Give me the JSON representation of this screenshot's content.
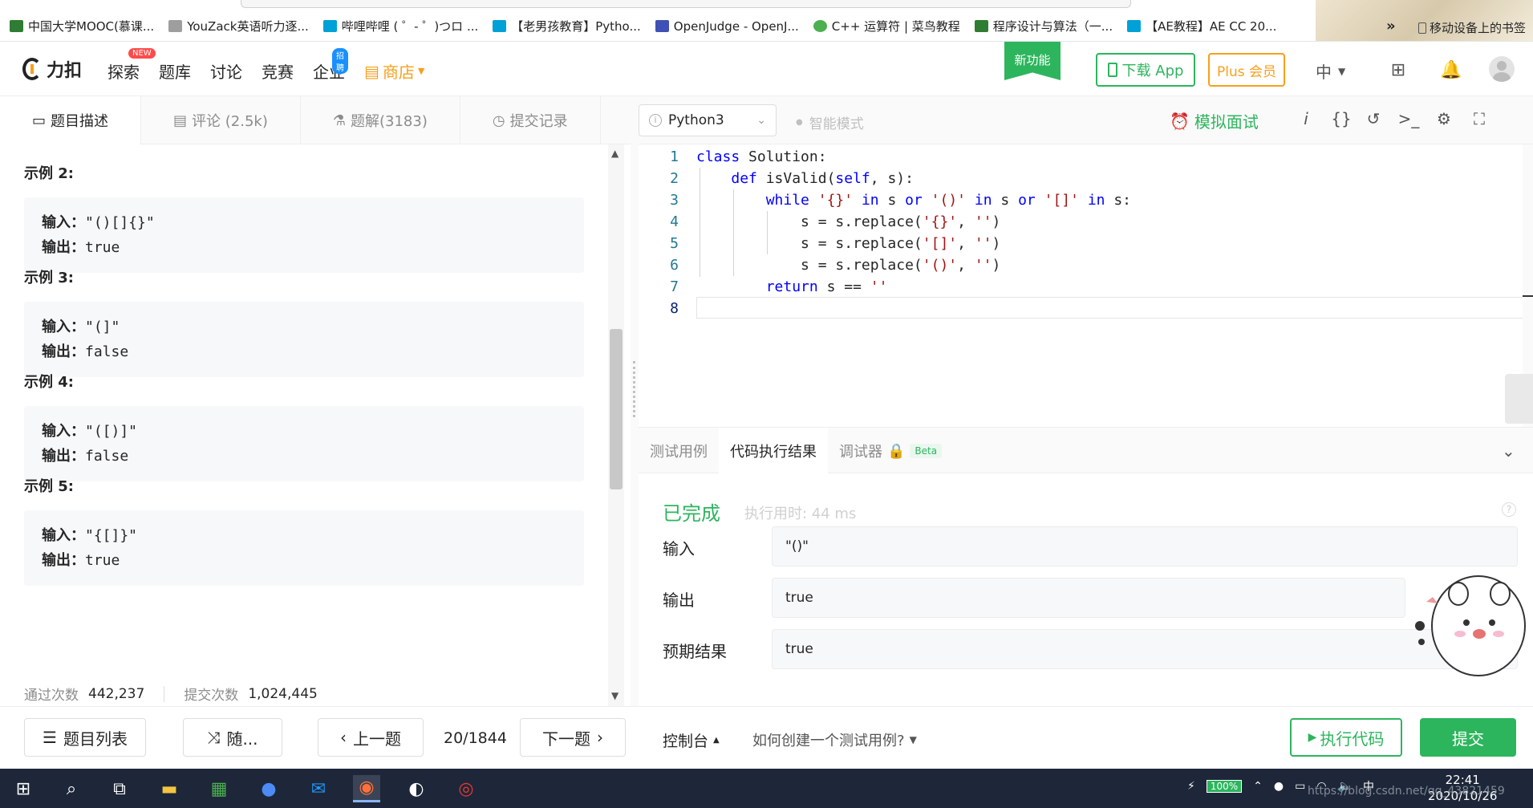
{
  "bookmarks": {
    "items": [
      {
        "label": "中国大学MOOC(慕课...",
        "color": "#2e7d32"
      },
      {
        "label": "YouZack英语听力逐...",
        "color": "#9e9e9e"
      },
      {
        "label": "哔哩哔哩 ( ゜- ゜)つロ ...",
        "color": "#00a1d6"
      },
      {
        "label": "【老男孩教育】Pytho...",
        "color": "#00a1d6"
      },
      {
        "label": "OpenJudge - OpenJ...",
        "color": "#3f51b5"
      },
      {
        "label": "C++ 运算符 | 菜鸟教程",
        "color": "#4caf50"
      },
      {
        "label": "程序设计与算法（一...",
        "color": "#2e7d32"
      },
      {
        "label": "【AE教程】AE CC 20...",
        "color": "#00a1d6"
      }
    ],
    "more": "»",
    "mobile": "移动设备上的书签"
  },
  "header": {
    "logo": "力扣",
    "nav": {
      "explore": "探索",
      "explore_tag": "NEW",
      "problems": "题库",
      "discuss": "讨论",
      "contest": "竞赛",
      "enterprise": "企业",
      "enterprise_tag": "招聘",
      "store": "商店"
    },
    "new_feature": "新功能",
    "download_app": "下载 App",
    "plus": "Plus 会员",
    "lang": "中"
  },
  "left_tabs": {
    "description": "题目描述",
    "comments": "评论 (2.5k)",
    "solutions": "题解(3183)",
    "submissions": "提交记录"
  },
  "examples": [
    {
      "title": "示例 2:",
      "input_label": "输入：",
      "input": "\"()[]{}\"",
      "output_label": "输出：",
      "output": "true"
    },
    {
      "title": "示例 3:",
      "input_label": "输入：",
      "input": "\"(]\"",
      "output_label": "输出：",
      "output": "false"
    },
    {
      "title": "示例 4:",
      "input_label": "输入：",
      "input": "\"([)]\"",
      "output_label": "输出：",
      "output": "false"
    },
    {
      "title": "示例 5:",
      "input_label": "输入：",
      "input": "\"{[]}\"",
      "output_label": "输出：",
      "output": "true"
    }
  ],
  "stats": {
    "passed_label": "通过次数",
    "passed": "442,237",
    "submitted_label": "提交次数",
    "submitted": "1,024,445"
  },
  "editor_toolbar": {
    "language": "Python3",
    "smart_mode": "智能模式",
    "mock_interview": "模拟面试"
  },
  "code": {
    "lines": [
      "1",
      "2",
      "3",
      "4",
      "5",
      "6",
      "7",
      "8"
    ]
  },
  "result_tabs": {
    "testcase": "测试用例",
    "result": "代码执行结果",
    "debugger": "调试器",
    "beta": "Beta"
  },
  "result": {
    "status": "已完成",
    "time": "执行用时: 44 ms",
    "input_label": "输入",
    "input": "\"()\"",
    "output_label": "输出",
    "output": "true",
    "expected_label": "预期结果",
    "expected": "true"
  },
  "bottom": {
    "problem_list": "题目列表",
    "random": "随...",
    "prev": "上一题",
    "page": "20/1844",
    "next": "下一题",
    "console": "控制台",
    "howto": "如何创建一个测试用例?",
    "run": "执行代码",
    "submit": "提交"
  },
  "taskbar": {
    "battery": "100%",
    "time": "22:41",
    "date": "2020/10/26",
    "watermark": "https://blog.csdn.net/qq_43821459"
  },
  "colors": {
    "brand_green": "#2db55d",
    "brand_orange": "#f89f1b",
    "keyword_blue": "#0000ff",
    "string_red": "#a31515"
  }
}
